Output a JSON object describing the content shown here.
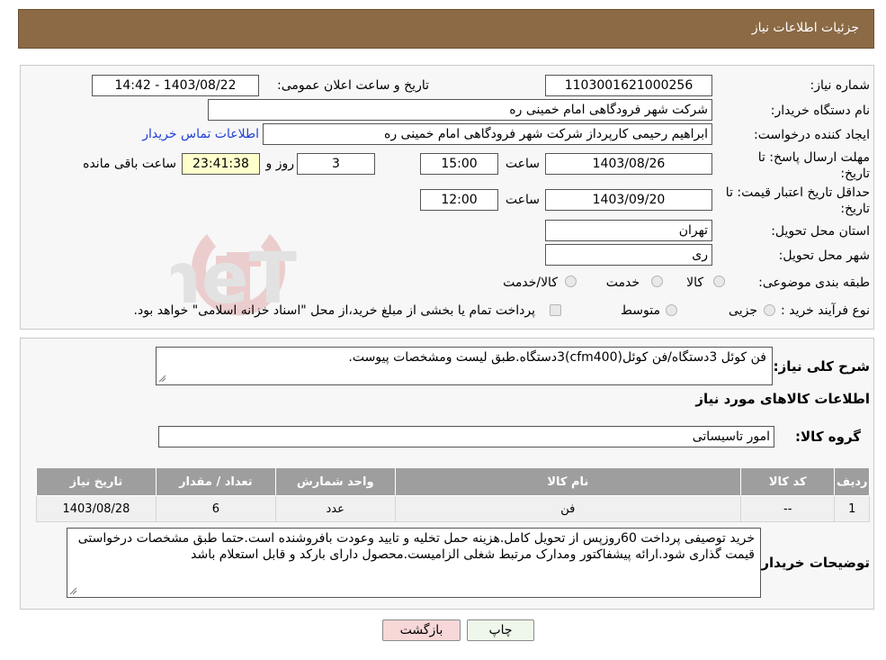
{
  "header": {
    "title": "جزئیات اطلاعات نیاز"
  },
  "form": {
    "need_number_label": "شماره نیاز:",
    "need_number": "1103001621000256",
    "announce_label": "تاریخ و ساعت اعلان عمومی:",
    "announce_value": "1403/08/22 - 14:42",
    "buyer_org_label": "نام دستگاه خریدار:",
    "buyer_org": "شرکت شهر فرودگاهی امام خمینی  ره",
    "creator_label": "ایجاد کننده درخواست:",
    "creator": "ابراهیم رحیمی کارپرداز شرکت شهر فرودگاهی امام خمینی  ره",
    "contact_link": "اطلاعات تماس خریدار",
    "deadline_label_1": "مهلت ارسال پاسخ: تا",
    "deadline_label_2": "تاریخ:",
    "deadline_date": "1403/08/26",
    "time_label": "ساعت",
    "deadline_time": "15:00",
    "days_value": "3",
    "days_label": "روز و",
    "remaining_time": "23:41:38",
    "remaining_label": "ساعت باقی مانده",
    "validity_label_1": "حداقل تاریخ اعتبار قیمت: تا",
    "validity_label_2": "تاریخ:",
    "validity_date": "1403/09/20",
    "validity_time_label": "ساعت",
    "validity_time": "12:00",
    "province_label": "استان محل تحویل:",
    "province": "تهران",
    "city_label": "شهر محل تحویل:",
    "city": "ری",
    "category_label": "طبقه بندی موضوعی:",
    "category_options": [
      "کالا",
      "خدمت",
      "کالا/خدمت"
    ],
    "process_label": "نوع فرآیند خرید :",
    "process_options": [
      "جزیی",
      "متوسط"
    ],
    "process_note": "پرداخت تمام یا بخشی از مبلغ خرید،از محل \"اسناد خزانه اسلامی\" خواهد بود."
  },
  "summary": {
    "desc_label": "شرح کلی نیاز:",
    "desc_value": "فن کوئل 3دستگاه/فن کوئل(cfm400)3دستگاه.طبق لیست ومشخصات پیوست.",
    "goods_info_title": "اطلاعات کالاهای مورد نیاز",
    "group_label": "گروه کالا:",
    "group_value": "امور تاسیساتی",
    "table": {
      "headers": [
        "ردیف",
        "کد کالا",
        "نام کالا",
        "واحد شمارش",
        "تعداد / مقدار",
        "تاریخ نیاز"
      ],
      "rows": [
        [
          "1",
          "--",
          "فن",
          "عدد",
          "6",
          "1403/08/28"
        ]
      ]
    },
    "buyer_notes_label": "توضیحات خریدار:",
    "buyer_notes": "خرید توصیفی پرداخت 60روزپس از تحویل کامل.هزینه حمل تخلیه و تایید وعودت  بافروشنده است.حتما طبق مشخصات درخواستی قیمت گذاری شود.ارائه پیشفاکتور ومدارک مرتبط شغلی  الزامیست.محصول دارای بارکد و قابل استعلام باشد"
  },
  "buttons": {
    "print": "چاپ",
    "back": "بازگشت"
  },
  "watermark": {
    "text": "AriaTender.neT"
  },
  "colors": {
    "header_bg": "#8b6a45",
    "table_header": "#9e9e9e",
    "link": "#1e3fd6",
    "back_btn": "#f7d7d7"
  }
}
